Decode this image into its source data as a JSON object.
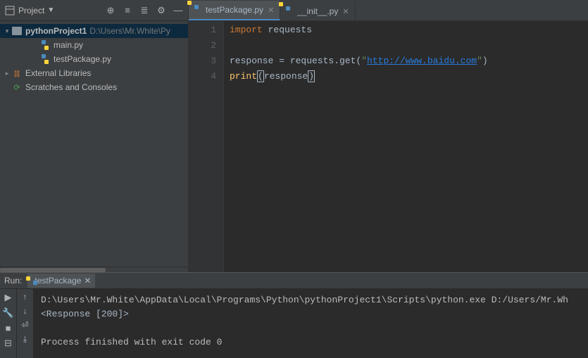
{
  "sidebar": {
    "title": "Project",
    "project": {
      "name": "pythonProject1",
      "path": "D:\\Users\\Mr.White\\Py"
    },
    "files": [
      {
        "name": "main.py"
      },
      {
        "name": "testPackage.py"
      }
    ],
    "external": "External Libraries",
    "scratches": "Scratches and Consoles"
  },
  "tabs": [
    {
      "name": "testPackage.py",
      "active": true
    },
    {
      "name": "__init__.py",
      "active": false
    }
  ],
  "code": {
    "lines": [
      "1",
      "2",
      "3",
      "4"
    ],
    "l1_import": "import",
    "l1_module": " requests",
    "l3_a": "response = requests.get(",
    "l3_q1": "\"",
    "l3_url": "http://www.baidu.com",
    "l3_q2": "\"",
    "l3_b": ")",
    "l4_print": "print",
    "l4_open": "(",
    "l4_arg": "response",
    "l4_close": ")"
  },
  "run": {
    "label": "Run:",
    "tab": "testPackage",
    "out1": "D:\\Users\\Mr.White\\AppData\\Local\\Programs\\Python\\pythonProject1\\Scripts\\python.exe D:/Users/Mr.Wh",
    "out2": "<Response [200]>",
    "out3": "",
    "out4": "Process finished with exit code 0"
  }
}
